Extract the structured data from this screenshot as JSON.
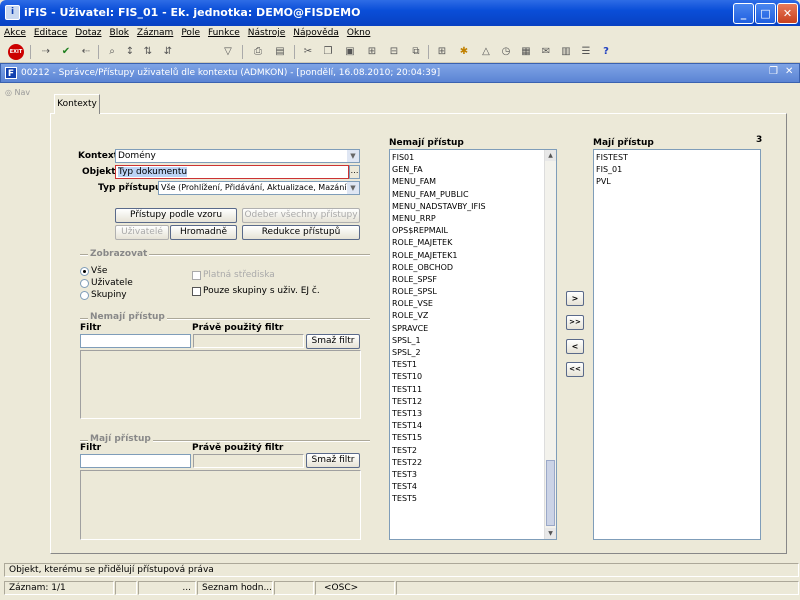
{
  "window": {
    "title": "iFIS - Uživatel: FIS_01 - Ek. jednotka: DEMO@FISDEMO",
    "app_icon": "i"
  },
  "menu": [
    "Akce",
    "Editace",
    "Dotaz",
    "Blok",
    "Záznam",
    "Pole",
    "Funkce",
    "Nástroje",
    "Nápověda",
    "Okno"
  ],
  "inner_window": {
    "title": "00212 - Správce/Přístupy uživatelů dle kontextu (ADMKON) - [pondělí, 16.08.2010; 20:04:39]"
  },
  "nav": {
    "label": "Nav"
  },
  "tab": {
    "label": "Kontexty"
  },
  "form": {
    "kontext_label": "Kontext",
    "kontext_value": "Domény",
    "objekt_label": "Objekt",
    "objekt_value": "Typ dokumentu",
    "typ_label": "Typ přístupu",
    "typ_value": "Vše (Prohlížení, Přidávání, Aktualizace, Mazání)"
  },
  "buttons": {
    "pristupy": "Přístupy podle vzoru",
    "odeber": "Odeber všechny přístupy",
    "uzivatele": "Uživatelé",
    "hromadne": "Hromadně",
    "redukce": "Redukce přístupů",
    "smaz1": "Smaž filtr",
    "smaz2": "Smaž filtr",
    "move_right": ">",
    "move_all_right": ">>",
    "move_left": "<",
    "move_all_left": "<<"
  },
  "zobrazovat": {
    "title": "Zobrazovat",
    "vse": "Vše",
    "uzivatele": "Uživatele",
    "skupiny": "Skupiny",
    "platna": "Platná střediska",
    "pouze": "Pouze skupiny s uživ. EJ č."
  },
  "filter_nemaji": {
    "title": "Nemají přístup",
    "filtr": "Filtr",
    "pravy": "Právě použitý filtr"
  },
  "filter_maji": {
    "title": "Mají přístup",
    "filtr": "Filtr",
    "pravy": "Právě použitý filtr"
  },
  "lists": {
    "nemaji_title": "Nemají přístup",
    "nemaji_items": [
      "FIS01",
      "GEN_FA",
      "MENU_FAM",
      "MENU_FAM_PUBLIC",
      "MENU_NADSTAVBY_IFIS",
      "MENU_RRP",
      "OPS$REPMAIL",
      "ROLE_MAJETEK",
      "ROLE_MAJETEK1",
      "ROLE_OBCHOD",
      "ROLE_SPSF",
      "ROLE_SPSL",
      "ROLE_VSE",
      "ROLE_VZ",
      "SPRAVCE",
      "SPSL_1",
      "SPSL_2",
      "TEST1",
      "TEST10",
      "TEST11",
      "TEST12",
      "TEST13",
      "TEST14",
      "TEST15",
      "TEST2",
      "TEST22",
      "TEST3",
      "TEST4",
      "TEST5"
    ],
    "maji_title": "Mají přístup",
    "maji_count": "3",
    "maji_items": [
      "FISTEST",
      "FIS_01",
      "PVL"
    ]
  },
  "status": {
    "message": "Objekt, kterému se přidělují přístupová práva",
    "zaznam": "Záznam: 1/1",
    "dots": "...",
    "seznam": "Seznam hodn...",
    "osc": "<OSC>"
  },
  "colors": {
    "titlebar": "#0A4ED8",
    "selection": "#316AC5",
    "exit": "#CC0000"
  }
}
